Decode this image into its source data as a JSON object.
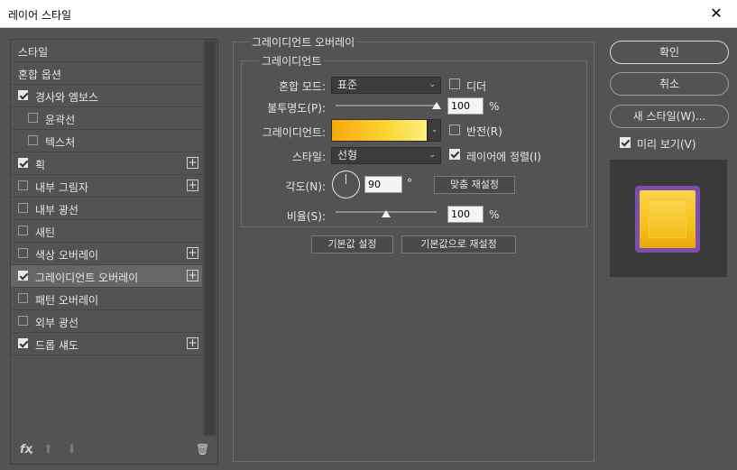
{
  "window": {
    "title": "레이어 스타일",
    "close_glyph": "✕"
  },
  "sidebar": {
    "items": [
      {
        "label": "스타일",
        "checkbox": false,
        "checked": false,
        "plus": false,
        "indent": 0,
        "selected": false
      },
      {
        "label": "혼합 옵션",
        "checkbox": false,
        "checked": false,
        "plus": false,
        "indent": 0,
        "selected": false
      },
      {
        "label": "경사와 엠보스",
        "checkbox": true,
        "checked": true,
        "plus": false,
        "indent": 0,
        "selected": false
      },
      {
        "label": "윤곽선",
        "checkbox": true,
        "checked": false,
        "plus": false,
        "indent": 1,
        "selected": false
      },
      {
        "label": "텍스처",
        "checkbox": true,
        "checked": false,
        "plus": false,
        "indent": 1,
        "selected": false
      },
      {
        "label": "획",
        "checkbox": true,
        "checked": true,
        "plus": true,
        "indent": 0,
        "selected": false
      },
      {
        "label": "내부 그림자",
        "checkbox": true,
        "checked": false,
        "plus": true,
        "indent": 0,
        "selected": false
      },
      {
        "label": "내부 광선",
        "checkbox": true,
        "checked": false,
        "plus": false,
        "indent": 0,
        "selected": false
      },
      {
        "label": "새틴",
        "checkbox": true,
        "checked": false,
        "plus": false,
        "indent": 0,
        "selected": false
      },
      {
        "label": "색상 오버레이",
        "checkbox": true,
        "checked": false,
        "plus": true,
        "indent": 0,
        "selected": false
      },
      {
        "label": "그레이디언트 오버레이",
        "checkbox": true,
        "checked": true,
        "plus": true,
        "indent": 0,
        "selected": true
      },
      {
        "label": "패턴 오버레이",
        "checkbox": true,
        "checked": false,
        "plus": false,
        "indent": 0,
        "selected": false
      },
      {
        "label": "외부 광선",
        "checkbox": true,
        "checked": false,
        "plus": false,
        "indent": 0,
        "selected": false
      },
      {
        "label": "드롭 섀도",
        "checkbox": true,
        "checked": true,
        "plus": true,
        "indent": 0,
        "selected": false
      }
    ],
    "plus_glyph": "+",
    "bottom": {
      "fx": "fx",
      "fx_caret": "▾",
      "up": "⬆",
      "down": "⬇",
      "trash": "🗑"
    }
  },
  "panel": {
    "section_title": "그레이디언트 오버레이",
    "group_title": "그레이디언트",
    "blend_mode_label": "혼합 모드:",
    "blend_mode_value": "표준",
    "dither_label": "디더",
    "opacity_label": "불투명도(P):",
    "opacity_value": "100",
    "opacity_unit": "%",
    "opacity_level": 1.0,
    "gradient_label": "그레이디언트:",
    "reverse_label": "반전(R)",
    "style_label": "스타일:",
    "style_value": "선형",
    "align_label": "레이어에 정렬(I)",
    "angle_label": "각도(N):",
    "angle_value": "90",
    "angle_unit": "°",
    "reset_alignment_label": "맞춤 재설정",
    "scale_label": "비율(S):",
    "scale_value": "100",
    "scale_unit": "%",
    "scale_level": 0.5,
    "make_default_label": "기본값 설정",
    "reset_default_label": "기본값으로 재설정",
    "dropdown_arrow": "⌄",
    "colors": {
      "gradient_start": "#f7a90e",
      "gradient_end": "#fdf07a"
    }
  },
  "actions": {
    "ok_label": "확인",
    "cancel_label": "취소",
    "new_style_label": "새 스타일(W)...",
    "preview_label": "미리 보기(V)"
  },
  "preview": {
    "frame_color": "#7b4fae",
    "tile_color": "#f6c11e",
    "background": "#3a3a3a"
  }
}
